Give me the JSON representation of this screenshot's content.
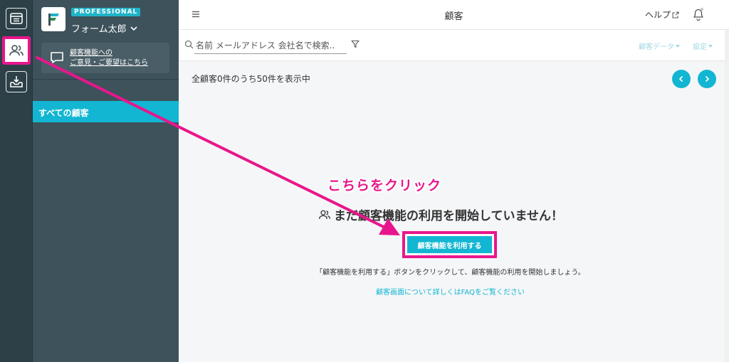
{
  "rail": {
    "items": [
      {
        "name": "forms-icon"
      },
      {
        "name": "customers-icon"
      },
      {
        "name": "inbox-download-icon"
      }
    ]
  },
  "sidebar": {
    "plan_badge": "PROFESSIONAL",
    "user_name": "フォーム太郎",
    "feedback_line1": "顧客機能への",
    "feedback_line2": "ご意見・ご要望はこちら",
    "nav_all_customers": "すべての顧客"
  },
  "header": {
    "title": "顧客",
    "help_label": "ヘルプ"
  },
  "toolbar": {
    "search_placeholder": "名前 メールアドレス 会社名で検索..",
    "customer_data_label": "顧客データ",
    "settings_label": "設定"
  },
  "main": {
    "count_text": "全顧客0件のうち50件を表示中",
    "callout": "こちらをクリック",
    "empty_title": "まだ顧客機能の利用を開始していません！",
    "cta_label": "顧客機能を利用する",
    "description": "「顧客機能を利用する」ボタンをクリックして、顧客機能の利用を開始しましょう。",
    "faq_link": "顧客画面について詳しくはFAQをご覧ください"
  },
  "colors": {
    "accent": "#12b6d2",
    "highlight": "#e8168c",
    "sidebar_bg": "#3d525b",
    "rail_bg": "#2d4048"
  }
}
